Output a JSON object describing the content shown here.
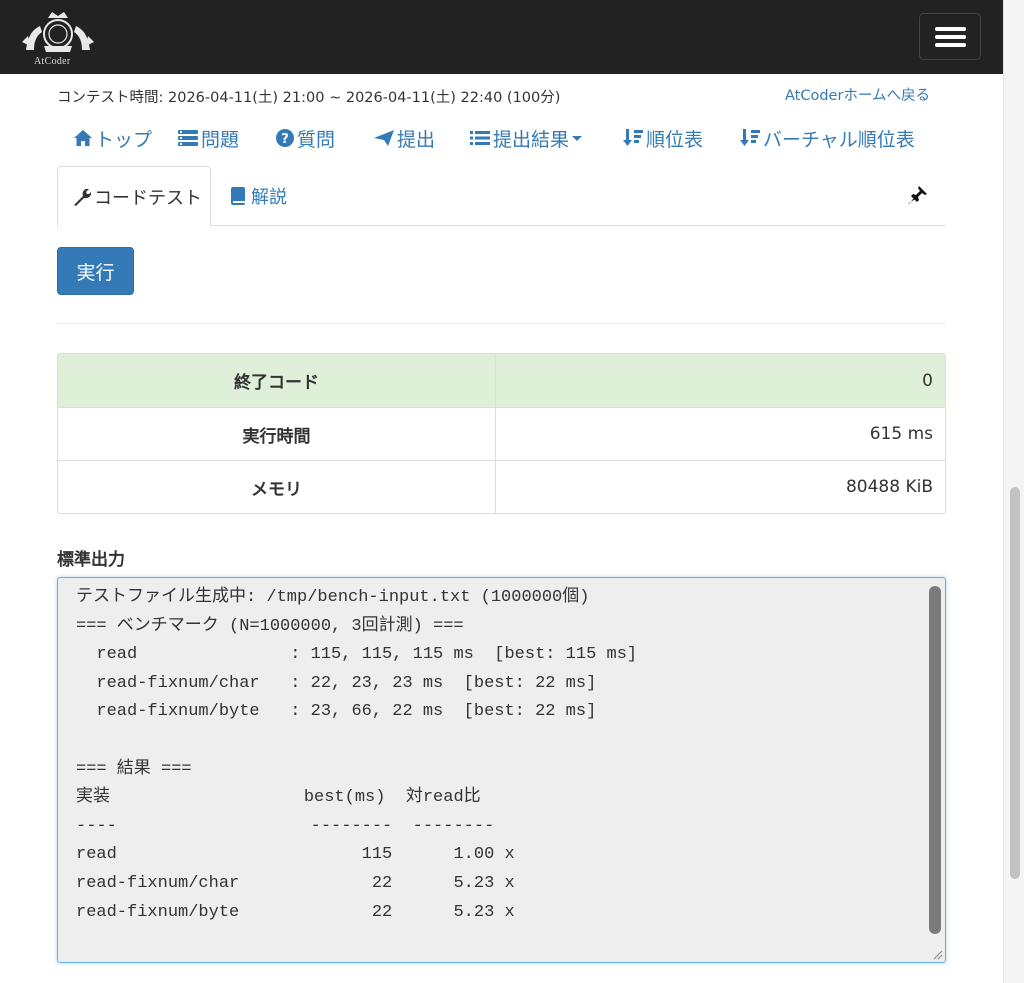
{
  "header": {
    "logo_text": "AtCoder",
    "menu_label": "menu"
  },
  "contest": {
    "time_text": "コンテスト時間: 2026-04-11(土) 21:00 ~ 2026-04-11(土) 22:40 (100分)",
    "home_link": "AtCoderホームへ戻る"
  },
  "nav": {
    "top": "トップ",
    "problems": "問題",
    "questions": "質問",
    "submit": "提出",
    "results": "提出結果",
    "standings": "順位表",
    "virtual_standings": "バーチャル順位表"
  },
  "tabs": {
    "code_test": "コードテスト",
    "editorial": "解説"
  },
  "run_button": "実行",
  "result": {
    "rows": [
      {
        "label": "終了コード",
        "value": "0"
      },
      {
        "label": "実行時間",
        "value": "615 ms"
      },
      {
        "label": "メモリ",
        "value": "80488 KiB"
      }
    ]
  },
  "stdout": {
    "label": "標準出力",
    "content": "テストファイル生成中: /tmp/bench-input.txt (1000000個)\n=== ベンチマーク (N=1000000, 3回計測) ===\n  read               : 115, 115, 115 ms  [best: 115 ms]\n  read-fixnum/char   : 22, 23, 23 ms  [best: 22 ms]\n  read-fixnum/byte   : 23, 66, 22 ms  [best: 22 ms]\n\n=== 結果 ===\n実装                   best(ms)  対read比\n----                   --------  --------\nread                        115      1.00 x\nread-fixnum/char             22      5.23 x\nread-fixnum/byte             22      5.23 x"
  },
  "colors": {
    "navbar": "#222222",
    "link": "#337ab7",
    "success_row": "#dff0d8",
    "stdout_bg": "#eeeeee"
  }
}
